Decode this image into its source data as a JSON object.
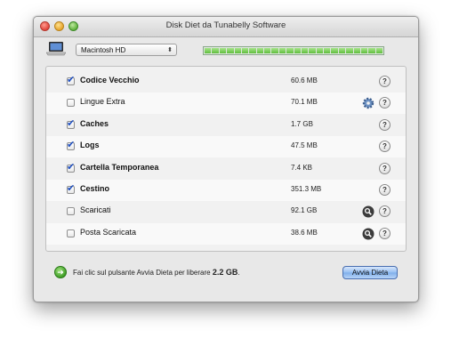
{
  "window": {
    "title": "Disk Diet da Tunabelly Software"
  },
  "toolbar": {
    "drive_icon": "laptop-drive-icon",
    "volume_selected": "Macintosh HD",
    "meter_segments_filled": 24,
    "meter_segments_total": 24
  },
  "items": [
    {
      "label": "Codice Vecchio",
      "size": "60.6 MB",
      "checked": true,
      "action_icon": ""
    },
    {
      "label": "Lingue Extra",
      "size": "70.1 MB",
      "checked": false,
      "action_icon": "gear-icon"
    },
    {
      "label": "Caches",
      "size": "1.7 GB",
      "checked": true,
      "action_icon": ""
    },
    {
      "label": "Logs",
      "size": "47.5 MB",
      "checked": true,
      "action_icon": ""
    },
    {
      "label": "Cartella Temporanea",
      "size": "7.4 KB",
      "checked": true,
      "action_icon": ""
    },
    {
      "label": "Cestino",
      "size": "351.3 MB",
      "checked": true,
      "action_icon": ""
    },
    {
      "label": "Scaricati",
      "size": "92.1 GB",
      "checked": false,
      "action_icon": "magnifier-icon"
    },
    {
      "label": "Posta Scaricata",
      "size": "38.6 MB",
      "checked": false,
      "action_icon": "magnifier-icon"
    }
  ],
  "help_label": "?",
  "footer": {
    "message_prefix": "Fai clic sul pulsante Avvia Dieta per liberare",
    "amount": "2.2 GB",
    "message_suffix": ".",
    "start_button": "Avvia Dieta"
  },
  "colors": {
    "accent_button": "#94bdf2",
    "meter_fill": "#5fbe3d",
    "checkmark": "#1f4fbf"
  }
}
